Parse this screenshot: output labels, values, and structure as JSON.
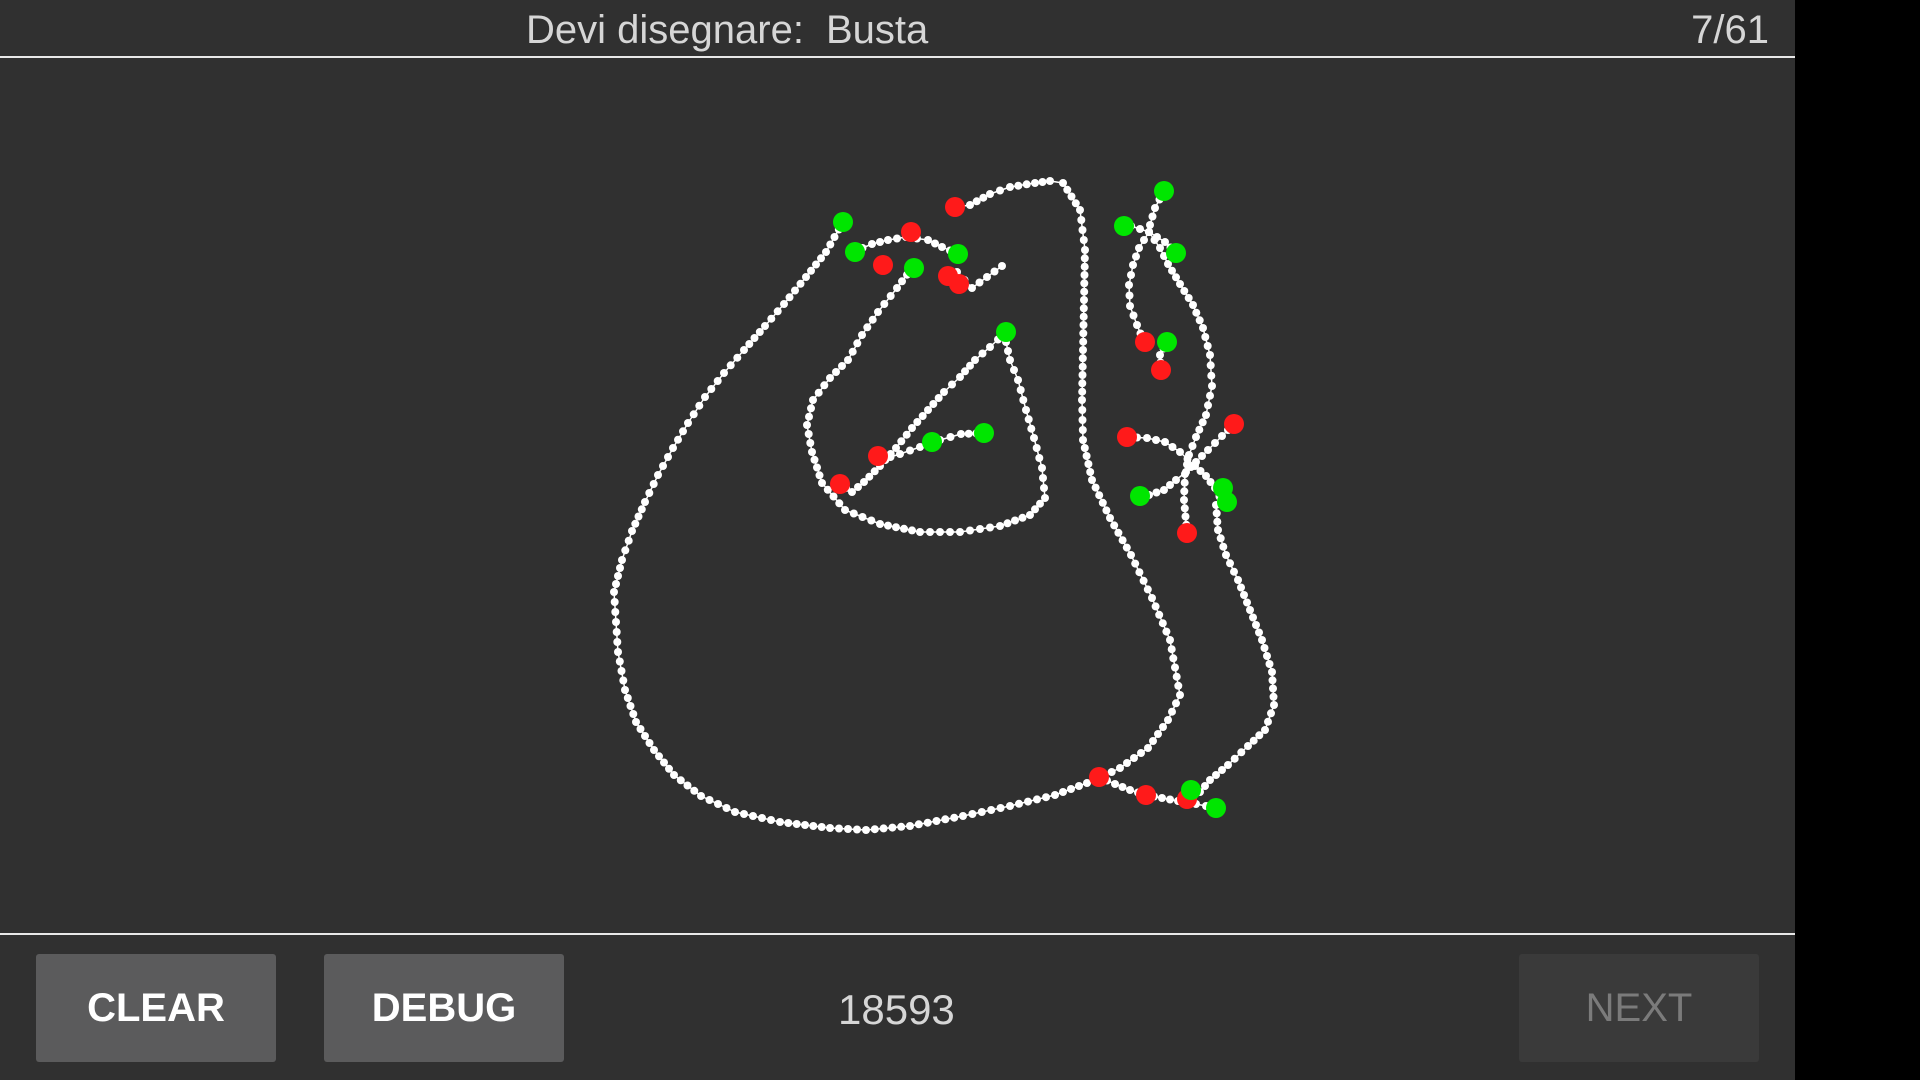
{
  "header": {
    "prompt_label": "Devi disegnare:",
    "prompt_word": "Busta",
    "counter": "7/61"
  },
  "footer": {
    "clear_label": "CLEAR",
    "debug_label": "DEBUG",
    "score": "18593",
    "next_label": "NEXT"
  },
  "colors": {
    "background": "#303030",
    "stroke": "#ffffff",
    "stroke_start": "#00e600",
    "stroke_end": "#ff1a1a"
  }
}
